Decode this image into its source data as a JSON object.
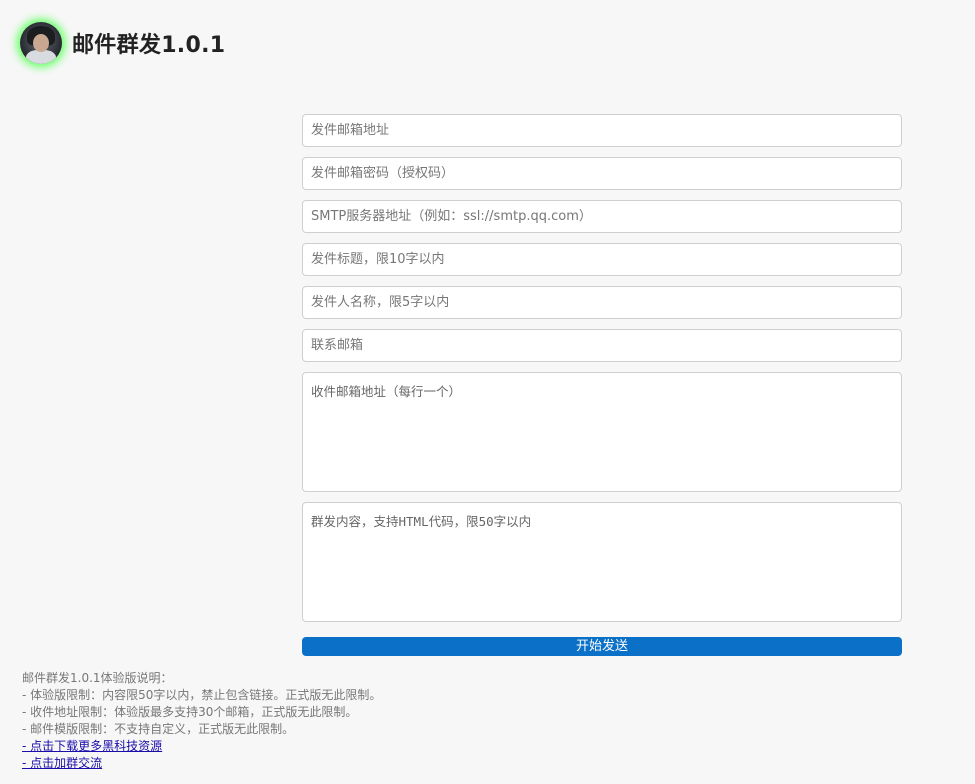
{
  "header": {
    "title": "邮件群发1.0.1",
    "avatar_icon": "user-avatar"
  },
  "form": {
    "sender_email_placeholder": "发件邮箱地址",
    "sender_password_placeholder": "发件邮箱密码（授权码）",
    "smtp_server_placeholder": "SMTP服务器地址（例如：ssl://smtp.qq.com）",
    "subject_placeholder": "发件标题，限10字以内",
    "sender_name_placeholder": "发件人名称，限5字以内",
    "contact_email_placeholder": "联系邮箱",
    "recipients_placeholder": "收件邮箱地址（每行一个）",
    "content_placeholder": "群发内容，支持HTML代码，限50字以内",
    "send_label": "开始发送"
  },
  "notes": {
    "heading": "邮件群发1.0.1体验版说明：",
    "lines": [
      "- 体验版限制：内容限50字以内，禁止包含链接。正式版无此限制。",
      "- 收件地址限制：体验版最多支持30个邮箱，正式版无此限制。",
      "- 邮件模版限制：不支持自定义，正式版无此限制。"
    ],
    "links": [
      "- 点击下载更多黑科技资源",
      "- 点击加群交流"
    ]
  },
  "colors": {
    "accent": "#0b70c8",
    "background": "#f7f7f7",
    "avatar_glow": "#7dff7d"
  }
}
